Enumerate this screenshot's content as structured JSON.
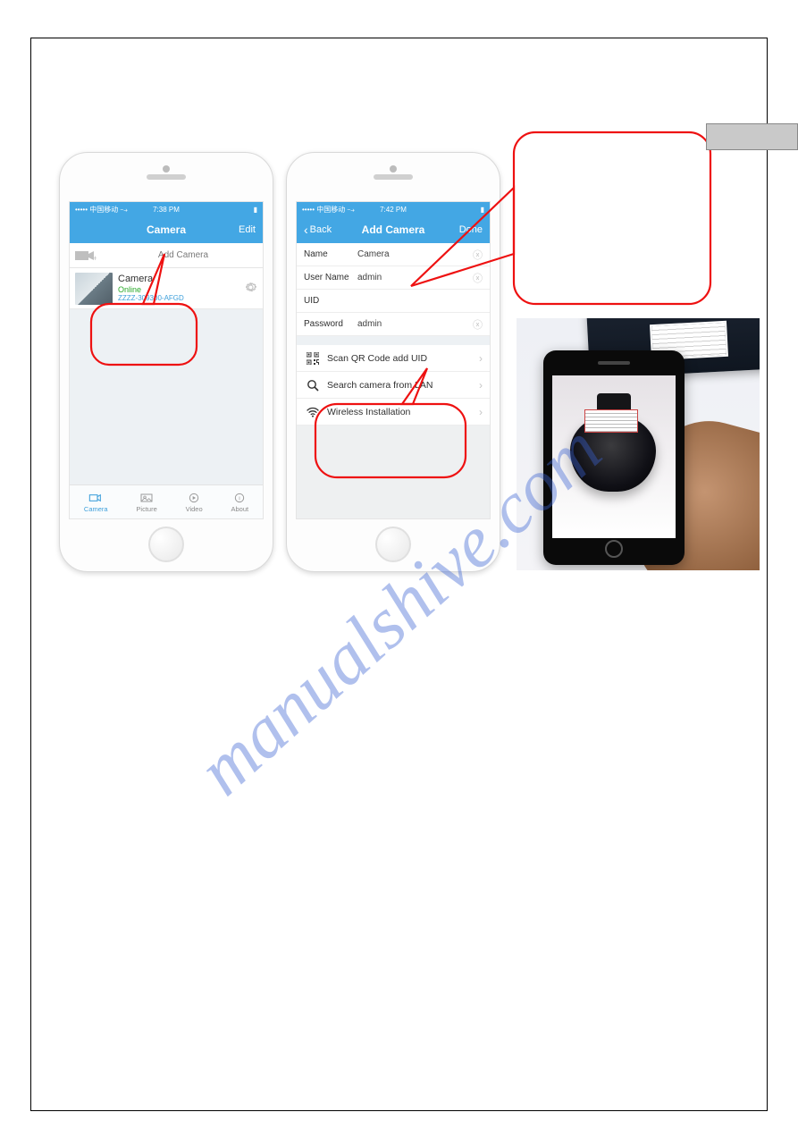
{
  "watermark": "manualshive.com",
  "phone1": {
    "status": {
      "carrier": "••••• 中国移动 ⤍",
      "time": "7:38 PM",
      "battery": "▮"
    },
    "navbar": {
      "title": "Camera",
      "right": "Edit"
    },
    "addcam_label": "Add Camera",
    "camera_item": {
      "title": "Camera",
      "status": "Online",
      "uid": "ZZZZ-309300-AFGD"
    },
    "tabs": {
      "camera": "Camera",
      "picture": "Picture",
      "video": "Video",
      "about": "About"
    }
  },
  "phone2": {
    "status": {
      "carrier": "••••• 中国移动 ⤍",
      "time": "7:42 PM",
      "battery": "▮"
    },
    "navbar": {
      "back": "Back",
      "title": "Add Camera",
      "done": "Done"
    },
    "form": {
      "name": {
        "label": "Name",
        "value": "Camera"
      },
      "user": {
        "label": "User Name",
        "value": "admin"
      },
      "uid": {
        "label": "UID",
        "value": ""
      },
      "password": {
        "label": "Password",
        "value": "admin"
      }
    },
    "actions": {
      "qr": "Scan QR Code add UID",
      "lan": "Search camera from LAN",
      "wifi": "Wireless Installation"
    }
  }
}
